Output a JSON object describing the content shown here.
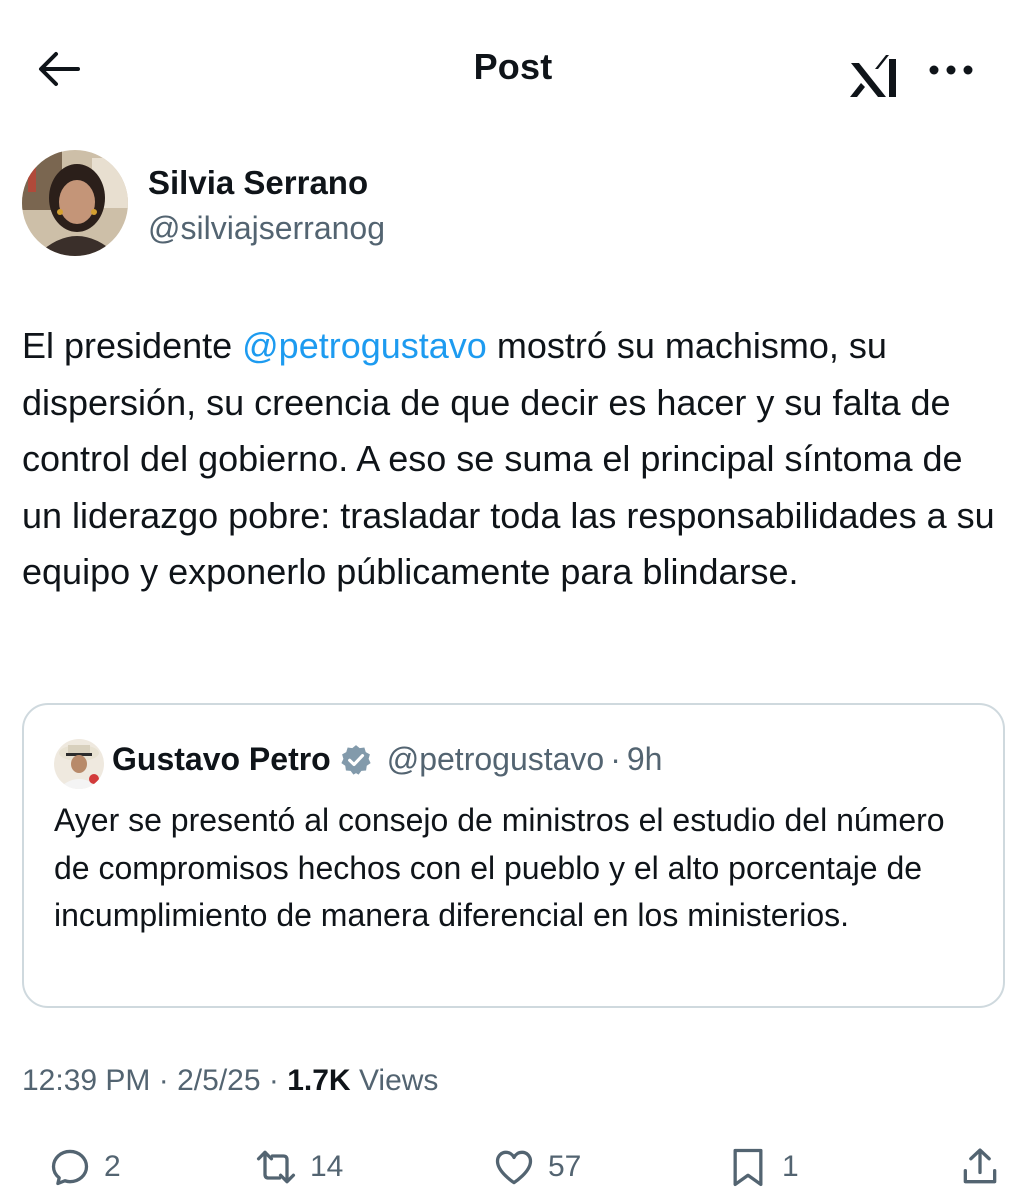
{
  "header": {
    "title": "Post",
    "back_icon": "arrow-left-icon",
    "grok_icon": "grok-icon",
    "more_icon": "more-horizontal-icon"
  },
  "author": {
    "name": "Silvia Serrano",
    "handle": "@silviajserranog"
  },
  "tweet": {
    "text_before": "El presidente ",
    "mention": "@petrogustavo",
    "text_after": " mostró su machismo, su dispersión, su creencia de que decir es hacer y su falta de control del gobierno. A eso se suma el principal síntoma de un liderazgo pobre: trasladar toda las responsabilidades a su equipo y exponerlo públicamente para blindarse."
  },
  "quote": {
    "name": "Gustavo Petro",
    "handle": "@petrogustavo",
    "separator": "·",
    "time": "9h",
    "text": "Ayer se presentó al consejo de ministros el estudio del número de compromisos hechos con el pueblo y el alto porcentaje de incumplimiento de manera diferencial en los ministerios."
  },
  "meta": {
    "time": "12:39 PM",
    "sep": "·",
    "date": "2/5/25",
    "views_count": "1.7K",
    "views_label": "Views"
  },
  "actions": {
    "replies": "2",
    "reposts": "14",
    "likes": "57",
    "bookmarks": "1"
  },
  "colors": {
    "link": "#1d9bf0",
    "secondary_text": "#536471",
    "primary_text": "#0f1419",
    "border": "#cfd9de",
    "verified": "#829aab"
  }
}
